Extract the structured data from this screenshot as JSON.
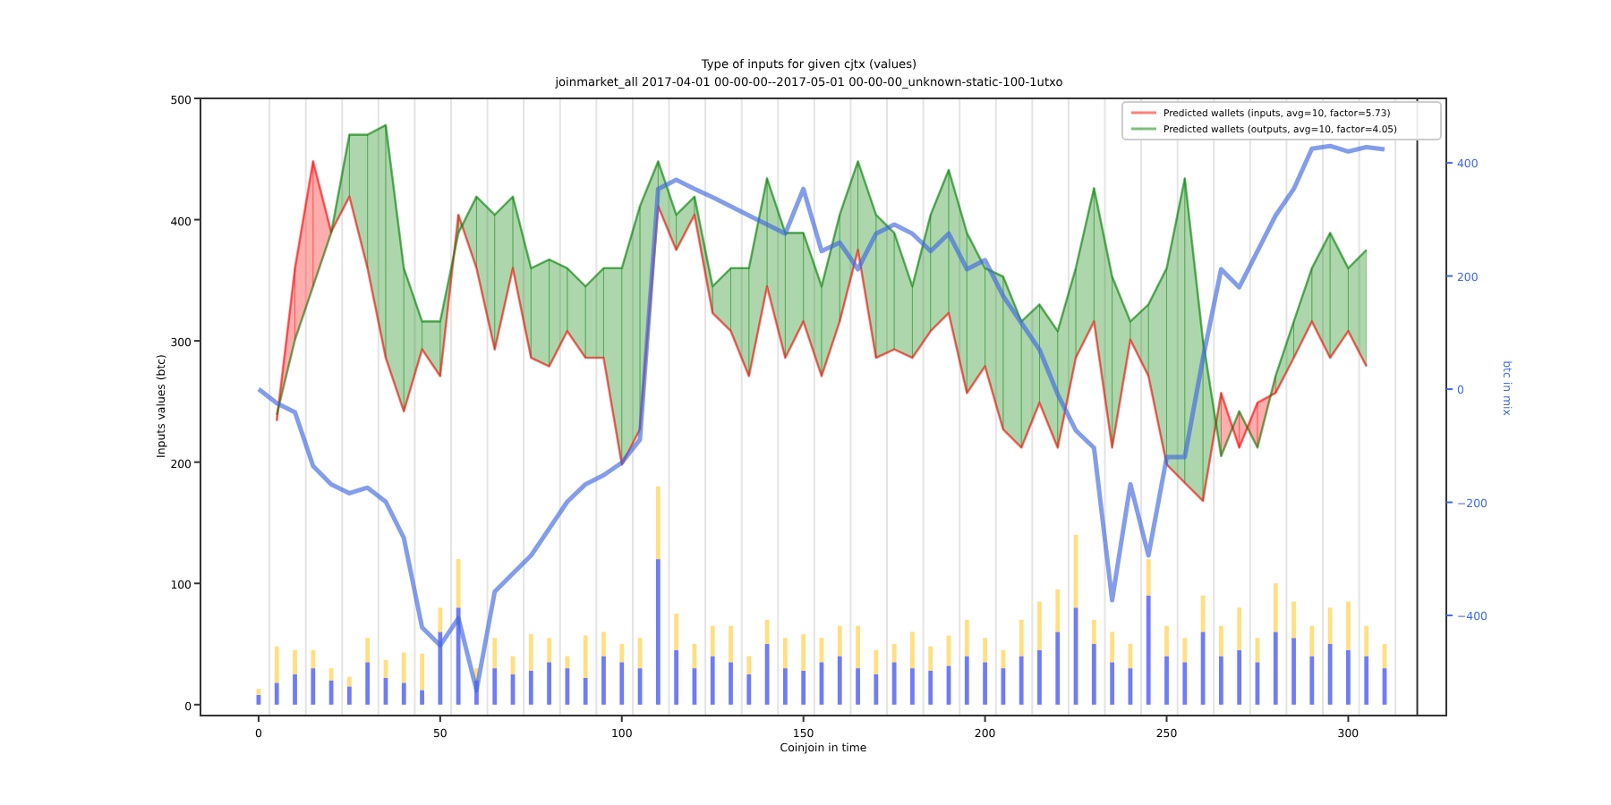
{
  "figure": {
    "chart_data": {
      "type": "line",
      "title": "Type of inputs for given cjtx (values)\njoinmarket_all 2017-04-01 00-00-00--2017-05-01 00-00-00_unknown-static-100-1utxo",
      "xlabel": "Coinjoin in time",
      "ylabel": "Inputs values (btc)",
      "y2label": "btc in mix",
      "xlim": [
        -16,
        327
      ],
      "ylim": [
        -9,
        500
      ],
      "y2lim": [
        -577,
        514
      ],
      "xticks": [
        0,
        50,
        100,
        150,
        200,
        250,
        300
      ],
      "yticks": [
        0,
        100,
        200,
        300,
        400,
        500
      ],
      "legend": true,
      "stacked": true,
      "ref_lines": [
        {
          "axis": "x",
          "value": 319
        }
      ],
      "y2ticks": [
        {
          "value": -400,
          "label": "−400"
        },
        {
          "value": -200,
          "label": "−200"
        },
        0,
        200,
        400
      ],
      "x": [
        0,
        5,
        10,
        15,
        20,
        25,
        30,
        35,
        40,
        45,
        50,
        55,
        60,
        65,
        70,
        75,
        80,
        85,
        90,
        95,
        100,
        105,
        110,
        115,
        120,
        125,
        130,
        135,
        140,
        145,
        150,
        155,
        160,
        165,
        170,
        175,
        180,
        185,
        190,
        195,
        200,
        205,
        210,
        215,
        220,
        225,
        230,
        235,
        240,
        245,
        250,
        255,
        260,
        265,
        270,
        275,
        280,
        285,
        290,
        295,
        300,
        305,
        310
      ],
      "series": [
        {
          "type": "bar",
          "color": "#3344ee",
          "axis": "y",
          "values": [
            8,
            18,
            25,
            30,
            20,
            15,
            35,
            22,
            18,
            12,
            60,
            80,
            20,
            30,
            25,
            28,
            35,
            30,
            22,
            40,
            35,
            30,
            120,
            45,
            30,
            40,
            35,
            25,
            50,
            30,
            28,
            35,
            40,
            30,
            25,
            35,
            30,
            28,
            32,
            40,
            35,
            30,
            40,
            45,
            60,
            80,
            50,
            35,
            30,
            90,
            40,
            35,
            60,
            40,
            45,
            35,
            60,
            55,
            40,
            50,
            45,
            40,
            30
          ]
        },
        {
          "type": "bar",
          "color": "#ffd24d",
          "axis": "y",
          "values": [
            5,
            30,
            20,
            15,
            10,
            8,
            20,
            15,
            25,
            30,
            20,
            40,
            10,
            25,
            15,
            30,
            20,
            10,
            35,
            20,
            15,
            25,
            60,
            30,
            20,
            25,
            30,
            15,
            20,
            25,
            30,
            20,
            25,
            35,
            20,
            15,
            30,
            20,
            25,
            30,
            20,
            15,
            30,
            40,
            35,
            60,
            20,
            25,
            20,
            30,
            25,
            20,
            30,
            25,
            35,
            20,
            40,
            30,
            25,
            30,
            40,
            25,
            20
          ]
        },
        {
          "name": "Predicted wallets (inputs, avg=10, factor=5.73)",
          "color": "#ff0000",
          "axis": "y",
          "values": [
            null,
            234,
            360,
            448,
            390,
            419,
            360,
            286,
            242,
            293,
            271,
            404,
            360,
            293,
            360,
            286,
            279,
            308,
            286,
            286,
            198,
            227,
            411,
            375,
            404,
            323,
            308,
            271,
            345,
            286,
            316,
            271,
            316,
            375,
            286,
            293,
            286,
            308,
            323,
            257,
            279,
            227,
            212,
            249,
            212,
            286,
            316,
            212,
            301,
            271,
            198,
            183,
            168,
            257,
            212,
            249,
            257,
            286,
            316,
            286,
            308,
            279,
            null
          ]
        },
        {
          "name": "Predicted wallets (outputs, avg=10, factor=4.05)",
          "color": "#008000",
          "axis": "y",
          "values": [
            null,
            239,
            301,
            345,
            389,
            470,
            470,
            478,
            360,
            316,
            316,
            389,
            419,
            404,
            419,
            360,
            367,
            360,
            345,
            360,
            360,
            411,
            448,
            404,
            419,
            345,
            360,
            360,
            434,
            389,
            389,
            345,
            404,
            448,
            404,
            389,
            345,
            404,
            441,
            389,
            360,
            353,
            316,
            330,
            308,
            360,
            426,
            353,
            316,
            330,
            360,
            434,
            301,
            205,
            242,
            212,
            271,
            316,
            360,
            389,
            360,
            375,
            null
          ]
        },
        {
          "color": "#4169e1",
          "axis": "y2",
          "values": [
            0,
            -25,
            -41,
            -136,
            -168,
            -184,
            -174,
            -199,
            -263,
            -421,
            -453,
            -405,
            -532,
            -358,
            -326,
            -294,
            -247,
            -199,
            -168,
            -152,
            -130,
            -89,
            354,
            370,
            354,
            339,
            323,
            307,
            291,
            275,
            354,
            244,
            259,
            212,
            275,
            291,
            275,
            244,
            275,
            212,
            228,
            165,
            117,
            70,
            -9,
            -73,
            -104,
            -373,
            -168,
            -294,
            -120,
            -120,
            54,
            212,
            180,
            244,
            307,
            354,
            425,
            430,
            420,
            428,
            424
          ]
        }
      ]
    }
  }
}
